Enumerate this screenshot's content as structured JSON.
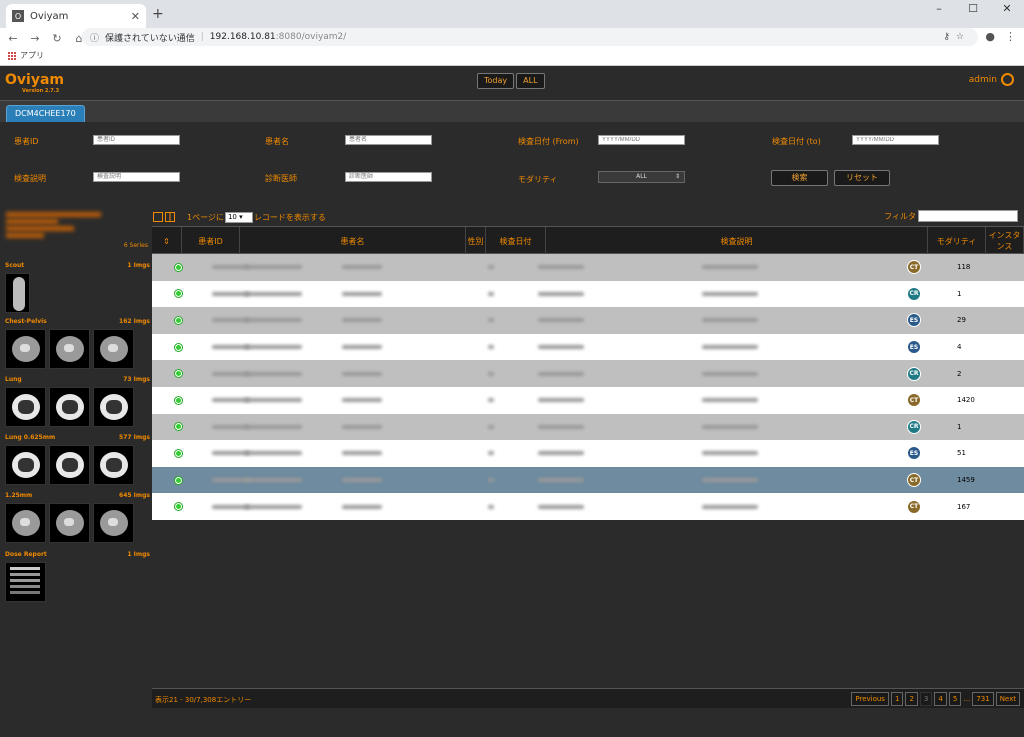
{
  "browser": {
    "tab_title": "Oviyam",
    "favicon_glyph": "O",
    "security_text": "保護されていない通信",
    "url_host": "192.168.10.81",
    "url_path": ":8080/oviyam2/",
    "bookmark_apps": "アプリ"
  },
  "app": {
    "logo": "Oviyam",
    "version": "Version 2.7.3",
    "today_button": "Today",
    "all_button": "ALL",
    "user": "admin",
    "server_tab": "DCM4CHEE170",
    "accent": "#f08a00"
  },
  "search": {
    "patient_id_label": "患者ID",
    "patient_id_placeholder": "患者ID",
    "patient_name_label": "患者名",
    "patient_name_placeholder": "患者名",
    "date_from_label": "検査日付 (From)",
    "date_from_placeholder": "YYYY/MM/DD",
    "date_to_label": "検査日付 (to)",
    "date_to_placeholder": "YYYY/MM/DD",
    "study_desc_label": "検査説明",
    "study_desc_placeholder": "検査説明",
    "physician_label": "診断医師",
    "physician_placeholder": "診断医師",
    "modality_label": "モダリティ",
    "modality_value": "ALL",
    "search_button": "検索",
    "reset_button": "リセット"
  },
  "sidebar": {
    "series_count": "6 Series",
    "groups": [
      {
        "name": "Scout",
        "count": "1 Imgs"
      },
      {
        "name": "Chest-Pelvis",
        "count": "162 Imgs"
      },
      {
        "name": "Lung",
        "count": "73 Imgs"
      },
      {
        "name": "Lung 0.625mm",
        "count": "577 Imgs"
      },
      {
        "name": "1.25mm",
        "count": "645 Imgs"
      },
      {
        "name": "Dose Report",
        "count": "1 Imgs"
      }
    ]
  },
  "grid": {
    "per_page_prefix": "1ページに",
    "per_page_value": "10",
    "per_page_suffix": "レコードを表示する",
    "filter_label": "フィルタ",
    "columns": {
      "patient_id": "患者ID",
      "patient_name": "患者名",
      "sex": "性別",
      "study_date": "検査日付",
      "study_desc": "検査説明",
      "modality": "モダリティ",
      "instances": "インスタンス"
    },
    "rows": [
      {
        "modality": "CT",
        "color": "#8a6a2a",
        "instances": "118"
      },
      {
        "modality": "CR",
        "color": "#1f7a86",
        "instances": "1"
      },
      {
        "modality": "ES",
        "color": "#2a5a8a",
        "instances": "29"
      },
      {
        "modality": "ES",
        "color": "#2a5a8a",
        "instances": "4"
      },
      {
        "modality": "CR",
        "color": "#1f7a86",
        "instances": "2"
      },
      {
        "modality": "CT",
        "color": "#8a6a2a",
        "instances": "1420"
      },
      {
        "modality": "CR",
        "color": "#1f7a86",
        "instances": "1"
      },
      {
        "modality": "ES",
        "color": "#2a5a8a",
        "instances": "51"
      },
      {
        "modality": "CT",
        "color": "#8a6a2a",
        "instances": "1459"
      },
      {
        "modality": "CT",
        "color": "#8a6a2a",
        "instances": "167"
      }
    ],
    "selected_row": 8
  },
  "pager": {
    "info": "表示21 - 30/7,308エントリー",
    "previous": "Previous",
    "pages": [
      "1",
      "2",
      "3",
      "4",
      "5"
    ],
    "current_page": "3",
    "ellipsis": "…",
    "last_page": "731",
    "next": "Next"
  }
}
